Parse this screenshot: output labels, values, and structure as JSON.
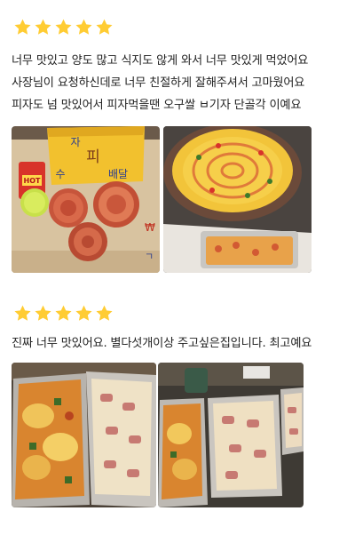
{
  "reviews": [
    {
      "rating": 5,
      "lines": [
        "너무 맛있고 양도 많고 식지도 않게 와서 너무 맛있게 먹었어요",
        "사장님이 요청하신데로 너무 친절하게 잘해주셔서 고마웠어요",
        "피자도 넘 맛있어서 피자먹을땐 오구쌀 ㅂ기자 단골각 이예요"
      ],
      "photos": [
        {
          "icon": "pizza-box-photo",
          "box_text": [
            "자",
            "배달",
            "피",
            "수"
          ],
          "badge": "HOT"
        },
        {
          "icon": "pizza-photo"
        }
      ]
    },
    {
      "rating": 5,
      "lines": [
        "진짜 너무 맛있어요. 별다섯개이상 주고싶은집입니다. 최고예요"
      ],
      "photos": [
        {
          "icon": "baked-dish-photo"
        },
        {
          "icon": "baked-dish-photo"
        }
      ]
    }
  ],
  "colors": {
    "star": "#ffcc33",
    "text": "#222222"
  }
}
